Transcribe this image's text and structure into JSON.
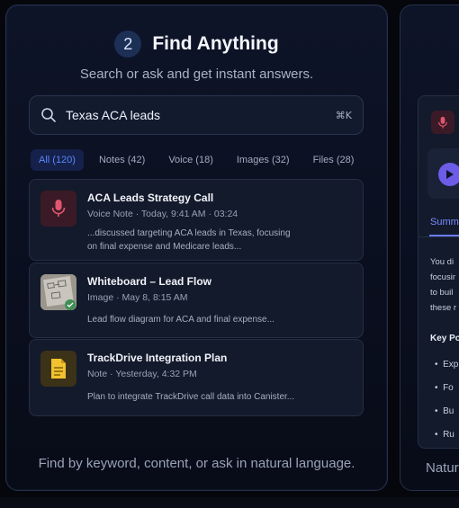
{
  "header": {
    "step_number": "2",
    "title": "Find Anything",
    "subtitle": "Search or ask and get instant answers."
  },
  "search": {
    "query": "Texas ACA leads",
    "shortcut": "⌘K"
  },
  "filters": [
    {
      "label": "All (120)",
      "active": true
    },
    {
      "label": "Notes (42)",
      "active": false
    },
    {
      "label": "Voice (18)",
      "active": false
    },
    {
      "label": "Images (32)",
      "active": false
    },
    {
      "label": "Files (28)",
      "active": false
    }
  ],
  "results": [
    {
      "title": "ACA Leads Strategy Call",
      "meta": "Voice Note  ·  Today, 9:41 AM  ·  03:24",
      "desc_line1": "...discussed targeting ACA leads in Texas, focusing",
      "desc_line2": "on final expense and Medicare leads...",
      "icon": "microphone-icon"
    },
    {
      "title": "Whiteboard – Lead Flow",
      "meta": "Image  ·  May 8, 8:15 AM",
      "desc_line1": "Lead flow diagram for ACA and final expense...",
      "icon": "whiteboard-thumbnail"
    },
    {
      "title": "TrackDrive Integration Plan",
      "meta": "Note  ·  Yesterday, 4:32 PM",
      "desc_line1": "Plan to integrate TrackDrive call data into Canister...",
      "icon": "document-icon"
    }
  ],
  "footer": "Find by keyword, content, or ask in natural language.",
  "side_panel": {
    "tab": "Summary",
    "body_lines": [
      "You di",
      "focusir",
      "to buil",
      "these r"
    ],
    "key_points_label": "Key Po",
    "bullets": [
      "Exp",
      "Fo",
      "Bu",
      "Ru"
    ],
    "footer": "Natur"
  },
  "colors": {
    "accent_blue": "#5a86ff",
    "mic_red": "#e0566f",
    "file_yellow": "#f2c230",
    "play_purple": "#6c5ce7"
  }
}
